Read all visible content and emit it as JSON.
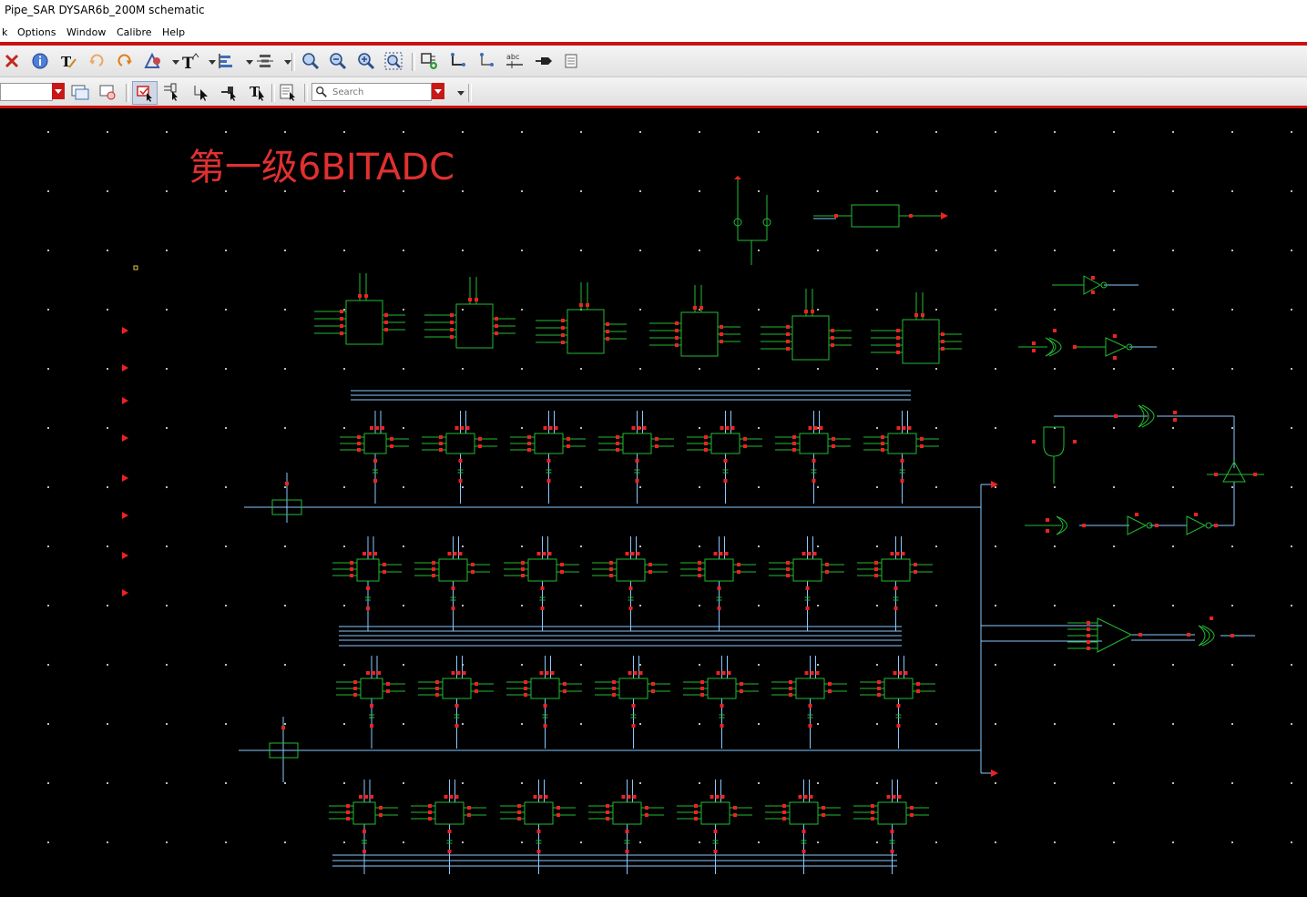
{
  "window": {
    "title": "Pipe_SAR DYSAR6b_200M schematic"
  },
  "menu": {
    "items": [
      "k",
      "Options",
      "Window",
      "Calibre",
      "Help"
    ]
  },
  "toolbar": {
    "icons": [
      "delete-icon",
      "info-icon",
      "text-edit-icon",
      "undo-icon",
      "redo-icon",
      "pin-icon",
      "text-icon",
      "align-icon",
      "distribute-icon",
      "zoom-in-icon",
      "zoom-out-icon",
      "zoom-fit-icon",
      "zoom-area-icon",
      "create-instance-icon",
      "wire-icon",
      "wire-narrow-icon",
      "label-icon",
      "pin-create-icon",
      "property-icon"
    ],
    "select_icons": [
      "select-toggle-icon",
      "select-instances-icon",
      "select-pointer-icon",
      "select-nets-icon",
      "select-text-icon",
      "edit-props-icon"
    ]
  },
  "search": {
    "placeholder": "Search"
  },
  "schematic": {
    "note": "第一级6BITADC",
    "colors": {
      "note": "#e03030",
      "instance": "#22bb33",
      "wire": "#88c8ff",
      "pin": "#ee2222",
      "grid": "#bbbbbb",
      "background": "#000000"
    }
  }
}
